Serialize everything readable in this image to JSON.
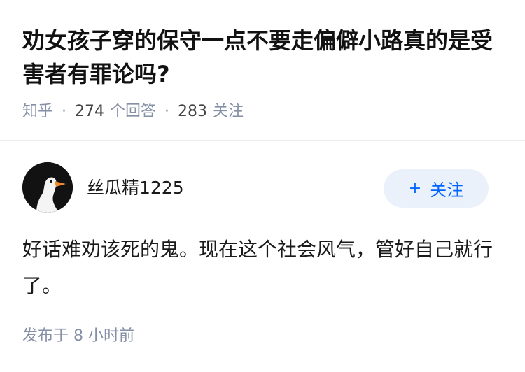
{
  "question": {
    "title": "劝女孩子穿的保守一点不要走偏僻小路真的是受害者有罪论吗?",
    "source": "知乎",
    "answers_count": "274",
    "answers_label": "个回答",
    "followers_count": "283",
    "followers_label": "关注"
  },
  "answer": {
    "author": {
      "name": "丝瓜精1225",
      "avatar": "goose-avatar"
    },
    "follow_button": {
      "icon": "plus-icon",
      "label": "关注"
    },
    "content": "好话难劝该死的鬼。现在这个社会风气，管好自己就行了。",
    "publish_time": "发布于 8 小时前"
  },
  "colors": {
    "accent": "#0066ff",
    "follow_bg": "#ebf1fb",
    "meta_gray": "#8590a6"
  }
}
